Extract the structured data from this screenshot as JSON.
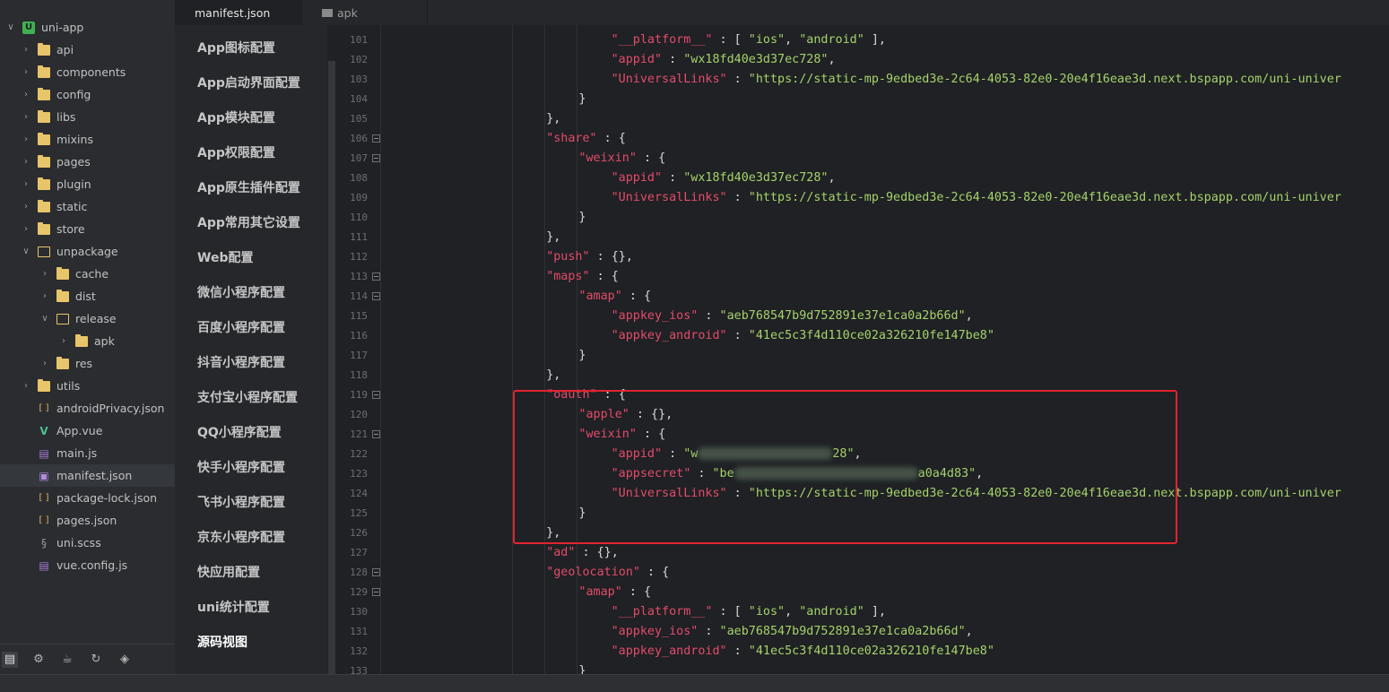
{
  "tree": {
    "items": [
      {
        "label": "uni-app",
        "depth": 0,
        "chev": "open",
        "icon": "project-icon"
      },
      {
        "label": "api",
        "depth": 1,
        "chev": "closed",
        "icon": "folder-icon"
      },
      {
        "label": "components",
        "depth": 1,
        "chev": "closed",
        "icon": "folder-icon"
      },
      {
        "label": "config",
        "depth": 1,
        "chev": "closed",
        "icon": "folder-icon"
      },
      {
        "label": "libs",
        "depth": 1,
        "chev": "closed",
        "icon": "folder-icon"
      },
      {
        "label": "mixins",
        "depth": 1,
        "chev": "closed",
        "icon": "folder-icon"
      },
      {
        "label": "pages",
        "depth": 1,
        "chev": "closed",
        "icon": "folder-icon"
      },
      {
        "label": "plugin",
        "depth": 1,
        "chev": "closed",
        "icon": "folder-icon"
      },
      {
        "label": "static",
        "depth": 1,
        "chev": "closed",
        "icon": "folder-icon"
      },
      {
        "label": "store",
        "depth": 1,
        "chev": "closed",
        "icon": "folder-icon"
      },
      {
        "label": "unpackage",
        "depth": 1,
        "chev": "open",
        "icon": "folder-open-icon"
      },
      {
        "label": "cache",
        "depth": 2,
        "chev": "closed",
        "icon": "folder-icon"
      },
      {
        "label": "dist",
        "depth": 2,
        "chev": "closed",
        "icon": "folder-icon"
      },
      {
        "label": "release",
        "depth": 2,
        "chev": "open",
        "icon": "folder-open-icon"
      },
      {
        "label": "apk",
        "depth": 3,
        "chev": "closed",
        "icon": "folder-icon"
      },
      {
        "label": "res",
        "depth": 2,
        "chev": "closed",
        "icon": "folder-icon"
      },
      {
        "label": "utils",
        "depth": 1,
        "chev": "closed",
        "icon": "folder-icon"
      },
      {
        "label": "androidPrivacy.json",
        "depth": 1,
        "chev": "none",
        "icon": "brackets-icon"
      },
      {
        "label": "App.vue",
        "depth": 1,
        "chev": "none",
        "icon": "vue-icon"
      },
      {
        "label": "main.js",
        "depth": 1,
        "chev": "none",
        "icon": "js-icon"
      },
      {
        "label": "manifest.json",
        "depth": 1,
        "chev": "none",
        "icon": "manifest-icon",
        "selected": true
      },
      {
        "label": "package-lock.json",
        "depth": 1,
        "chev": "none",
        "icon": "brackets-icon"
      },
      {
        "label": "pages.json",
        "depth": 1,
        "chev": "none",
        "icon": "brackets-icon"
      },
      {
        "label": "uni.scss",
        "depth": 1,
        "chev": "none",
        "icon": "scss-icon"
      },
      {
        "label": "vue.config.js",
        "depth": 1,
        "chev": "none",
        "icon": "js-icon"
      }
    ]
  },
  "footer": {
    "buttons": [
      "files-icon",
      "plugin-icon",
      "debug-icon",
      "refresh-icon",
      "web-icon"
    ]
  },
  "tabs": [
    {
      "label": "manifest.json",
      "active": true
    },
    {
      "label": "apk",
      "active": false
    }
  ],
  "settings": {
    "items": [
      "App图标配置",
      "App启动界面配置",
      "App模块配置",
      "App权限配置",
      "App原生插件配置",
      "App常用其它设置",
      "Web配置",
      "微信小程序配置",
      "百度小程序配置",
      "抖音小程序配置",
      "支付宝小程序配置",
      "QQ小程序配置",
      "快手小程序配置",
      "飞书小程序配置",
      "京东小程序配置",
      "快应用配置",
      "uni统计配置",
      "源码视图"
    ],
    "active_index": 17
  },
  "editor": {
    "lines": [
      {
        "n": "101",
        "fold": false,
        "indent": 3,
        "parts": [
          [
            "k",
            "\"__platform__\""
          ],
          [
            "p",
            " : [ "
          ],
          [
            "s",
            "\"ios\""
          ],
          [
            "p",
            ", "
          ],
          [
            "s",
            "\"android\""
          ],
          [
            "p",
            " ],"
          ]
        ]
      },
      {
        "n": "102",
        "fold": false,
        "indent": 3,
        "parts": [
          [
            "k",
            "\"appid\""
          ],
          [
            "p",
            " : "
          ],
          [
            "s",
            "\"wx18fd40e3d37ec728\""
          ],
          [
            "p",
            ","
          ]
        ]
      },
      {
        "n": "103",
        "fold": false,
        "indent": 3,
        "parts": [
          [
            "k",
            "\"UniversalLinks\""
          ],
          [
            "p",
            " : "
          ],
          [
            "s",
            "\"https://static-mp-9edbed3e-2c64-4053-82e0-20e4f16eae3d.next.bspapp.com/uni-univer"
          ]
        ]
      },
      {
        "n": "104",
        "fold": false,
        "indent": 2,
        "parts": [
          [
            "p",
            "}"
          ]
        ]
      },
      {
        "n": "105",
        "fold": false,
        "indent": 1,
        "parts": [
          [
            "p",
            "},"
          ]
        ]
      },
      {
        "n": "106",
        "fold": true,
        "indent": 1,
        "parts": [
          [
            "k",
            "\"share\""
          ],
          [
            "p",
            " : {"
          ]
        ]
      },
      {
        "n": "107",
        "fold": true,
        "indent": 2,
        "parts": [
          [
            "k",
            "\"weixin\""
          ],
          [
            "p",
            " : {"
          ]
        ]
      },
      {
        "n": "108",
        "fold": false,
        "indent": 3,
        "parts": [
          [
            "k",
            "\"appid\""
          ],
          [
            "p",
            " : "
          ],
          [
            "s",
            "\"wx18fd40e3d37ec728\""
          ],
          [
            "p",
            ","
          ]
        ]
      },
      {
        "n": "109",
        "fold": false,
        "indent": 3,
        "parts": [
          [
            "k",
            "\"UniversalLinks\""
          ],
          [
            "p",
            " : "
          ],
          [
            "s",
            "\"https://static-mp-9edbed3e-2c64-4053-82e0-20e4f16eae3d.next.bspapp.com/uni-univer"
          ]
        ]
      },
      {
        "n": "110",
        "fold": false,
        "indent": 2,
        "parts": [
          [
            "p",
            "}"
          ]
        ]
      },
      {
        "n": "111",
        "fold": false,
        "indent": 1,
        "parts": [
          [
            "p",
            "},"
          ]
        ]
      },
      {
        "n": "112",
        "fold": false,
        "indent": 1,
        "parts": [
          [
            "k",
            "\"push\""
          ],
          [
            "p",
            " : {},"
          ]
        ]
      },
      {
        "n": "113",
        "fold": true,
        "indent": 1,
        "parts": [
          [
            "k",
            "\"maps\""
          ],
          [
            "p",
            " : {"
          ]
        ]
      },
      {
        "n": "114",
        "fold": true,
        "indent": 2,
        "parts": [
          [
            "k",
            "\"amap\""
          ],
          [
            "p",
            " : {"
          ]
        ]
      },
      {
        "n": "115",
        "fold": false,
        "indent": 3,
        "parts": [
          [
            "k",
            "\"appkey_ios\""
          ],
          [
            "p",
            " : "
          ],
          [
            "s",
            "\"aeb768547b9d752891e37e1ca0a2b66d\""
          ],
          [
            "p",
            ","
          ]
        ]
      },
      {
        "n": "116",
        "fold": false,
        "indent": 3,
        "parts": [
          [
            "k",
            "\"appkey_android\""
          ],
          [
            "p",
            " : "
          ],
          [
            "s",
            "\"41ec5c3f4d110ce02a326210fe147be8\""
          ]
        ]
      },
      {
        "n": "117",
        "fold": false,
        "indent": 2,
        "parts": [
          [
            "p",
            "}"
          ]
        ]
      },
      {
        "n": "118",
        "fold": false,
        "indent": 1,
        "parts": [
          [
            "p",
            "},"
          ]
        ]
      },
      {
        "n": "119",
        "fold": true,
        "indent": 1,
        "parts": [
          [
            "k",
            "\"oauth\""
          ],
          [
            "p",
            " : {"
          ]
        ]
      },
      {
        "n": "120",
        "fold": false,
        "indent": 2,
        "parts": [
          [
            "k",
            "\"apple\""
          ],
          [
            "p",
            " : {},"
          ]
        ]
      },
      {
        "n": "121",
        "fold": true,
        "indent": 2,
        "parts": [
          [
            "k",
            "\"weixin\""
          ],
          [
            "p",
            " : {"
          ]
        ]
      },
      {
        "n": "122",
        "fold": false,
        "indent": 3,
        "parts": [
          [
            "k",
            "\"appid\""
          ],
          [
            "p",
            " : "
          ],
          [
            "s",
            "\"w"
          ],
          [
            "blur",
            "150"
          ],
          [
            "s",
            "28\""
          ],
          [
            "p",
            ","
          ]
        ]
      },
      {
        "n": "123",
        "fold": false,
        "indent": 3,
        "parts": [
          [
            "k",
            "\"appsecret\""
          ],
          [
            "p",
            " : "
          ],
          [
            "s",
            "\"be"
          ],
          [
            "blur",
            "205"
          ],
          [
            "s",
            "a0a4d83\""
          ],
          [
            "p",
            ","
          ]
        ]
      },
      {
        "n": "124",
        "fold": false,
        "indent": 3,
        "parts": [
          [
            "k",
            "\"UniversalLinks\""
          ],
          [
            "p",
            " : "
          ],
          [
            "s",
            "\"https://static-mp-9edbed3e-2c64-4053-82e0-20e4f16eae3d.next.bspapp.com/uni-univer"
          ]
        ]
      },
      {
        "n": "125",
        "fold": false,
        "indent": 2,
        "parts": [
          [
            "p",
            "}"
          ]
        ]
      },
      {
        "n": "126",
        "fold": false,
        "indent": 1,
        "parts": [
          [
            "p",
            "},"
          ]
        ]
      },
      {
        "n": "127",
        "fold": false,
        "indent": 1,
        "parts": [
          [
            "k",
            "\"ad\""
          ],
          [
            "p",
            " : {},"
          ]
        ]
      },
      {
        "n": "128",
        "fold": true,
        "indent": 1,
        "parts": [
          [
            "k",
            "\"geolocation\""
          ],
          [
            "p",
            " : {"
          ]
        ]
      },
      {
        "n": "129",
        "fold": true,
        "indent": 2,
        "parts": [
          [
            "k",
            "\"amap\""
          ],
          [
            "p",
            " : {"
          ]
        ]
      },
      {
        "n": "130",
        "fold": false,
        "indent": 3,
        "parts": [
          [
            "k",
            "\"__platform__\""
          ],
          [
            "p",
            " : [ "
          ],
          [
            "s",
            "\"ios\""
          ],
          [
            "p",
            ", "
          ],
          [
            "s",
            "\"android\""
          ],
          [
            "p",
            " ],"
          ]
        ]
      },
      {
        "n": "131",
        "fold": false,
        "indent": 3,
        "parts": [
          [
            "k",
            "\"appkey_ios\""
          ],
          [
            "p",
            " : "
          ],
          [
            "s",
            "\"aeb768547b9d752891e37e1ca0a2b66d\""
          ],
          [
            "p",
            ","
          ]
        ]
      },
      {
        "n": "132",
        "fold": false,
        "indent": 3,
        "parts": [
          [
            "k",
            "\"appkey_android\""
          ],
          [
            "p",
            " : "
          ],
          [
            "s",
            "\"41ec5c3f4d110ce02a326210fe147be8\""
          ]
        ]
      },
      {
        "n": "133",
        "fold": false,
        "indent": 2,
        "parts": [
          [
            "p",
            "}"
          ]
        ]
      }
    ]
  },
  "colors": {
    "key": "#e34b6b",
    "string": "#a6d26b",
    "highlight": "#e0242f"
  }
}
